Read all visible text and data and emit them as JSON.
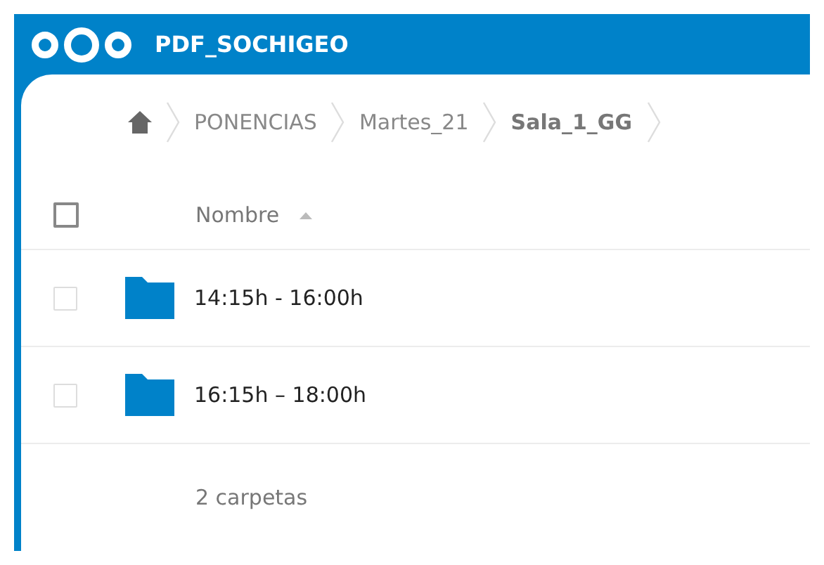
{
  "header": {
    "title": "PDF_SOCHIGEO"
  },
  "breadcrumb": [
    "PONENCIAS",
    "Martes_21",
    "Sala_1_GG"
  ],
  "table": {
    "select_all": {
      "checked": false
    },
    "columns": [
      {
        "label": "Nombre",
        "sorted": true,
        "ascending": true
      }
    ],
    "rows": [
      {
        "name": "14:15h - 16:00h",
        "kind": "folder",
        "checked": false
      },
      {
        "name": "16:15h – 18:00h",
        "kind": "folder",
        "checked": false
      }
    ]
  },
  "summary": "2 carpetas"
}
